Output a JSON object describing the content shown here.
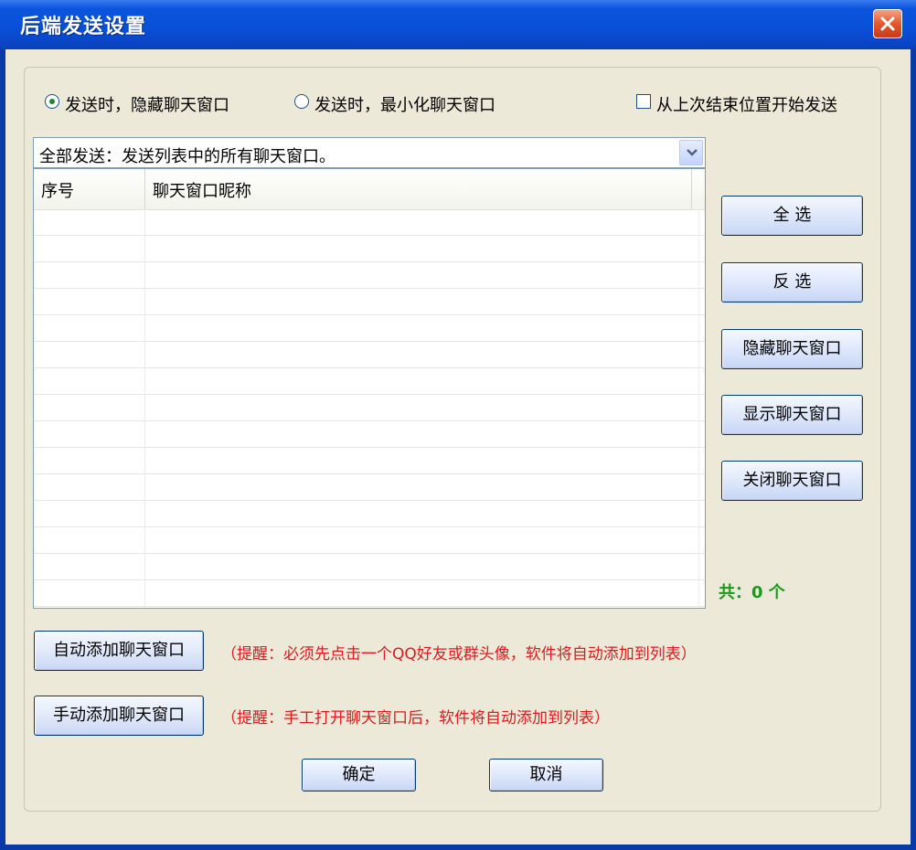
{
  "window": {
    "title": "后端发送设置"
  },
  "options": {
    "radio_hide": {
      "label": "发送时，隐藏聊天窗口",
      "checked": true
    },
    "radio_minimize": {
      "label": "发送时，最小化聊天窗口",
      "checked": false
    },
    "checkbox_resume": {
      "label": "从上次结束位置开始发送",
      "checked": false
    }
  },
  "send_mode": {
    "selected": "全部发送：发送列表中的所有聊天窗口。"
  },
  "list": {
    "columns": [
      "序号",
      "聊天窗口昵称"
    ],
    "rows": []
  },
  "side_buttons": {
    "select_all": "全  选",
    "invert": "反  选",
    "hide": "隐藏聊天窗口",
    "show": "显示聊天窗口",
    "close": "关闭聊天窗口"
  },
  "count_text": "共：0 个",
  "add": {
    "auto_label": "自动添加聊天窗口",
    "auto_hint": "（提醒：必须先点击一个QQ好友或群头像，软件将自动添加到列表）",
    "manual_label": "手动添加聊天窗口",
    "manual_hint": "（提醒：手工打开聊天窗口后，软件将自动添加到列表）"
  },
  "footer": {
    "ok": "确定",
    "cancel": "取消"
  },
  "colors": {
    "titlebar": "#0a54dd",
    "hint_red": "#e01b1b",
    "count_green": "#1a9a1a"
  }
}
